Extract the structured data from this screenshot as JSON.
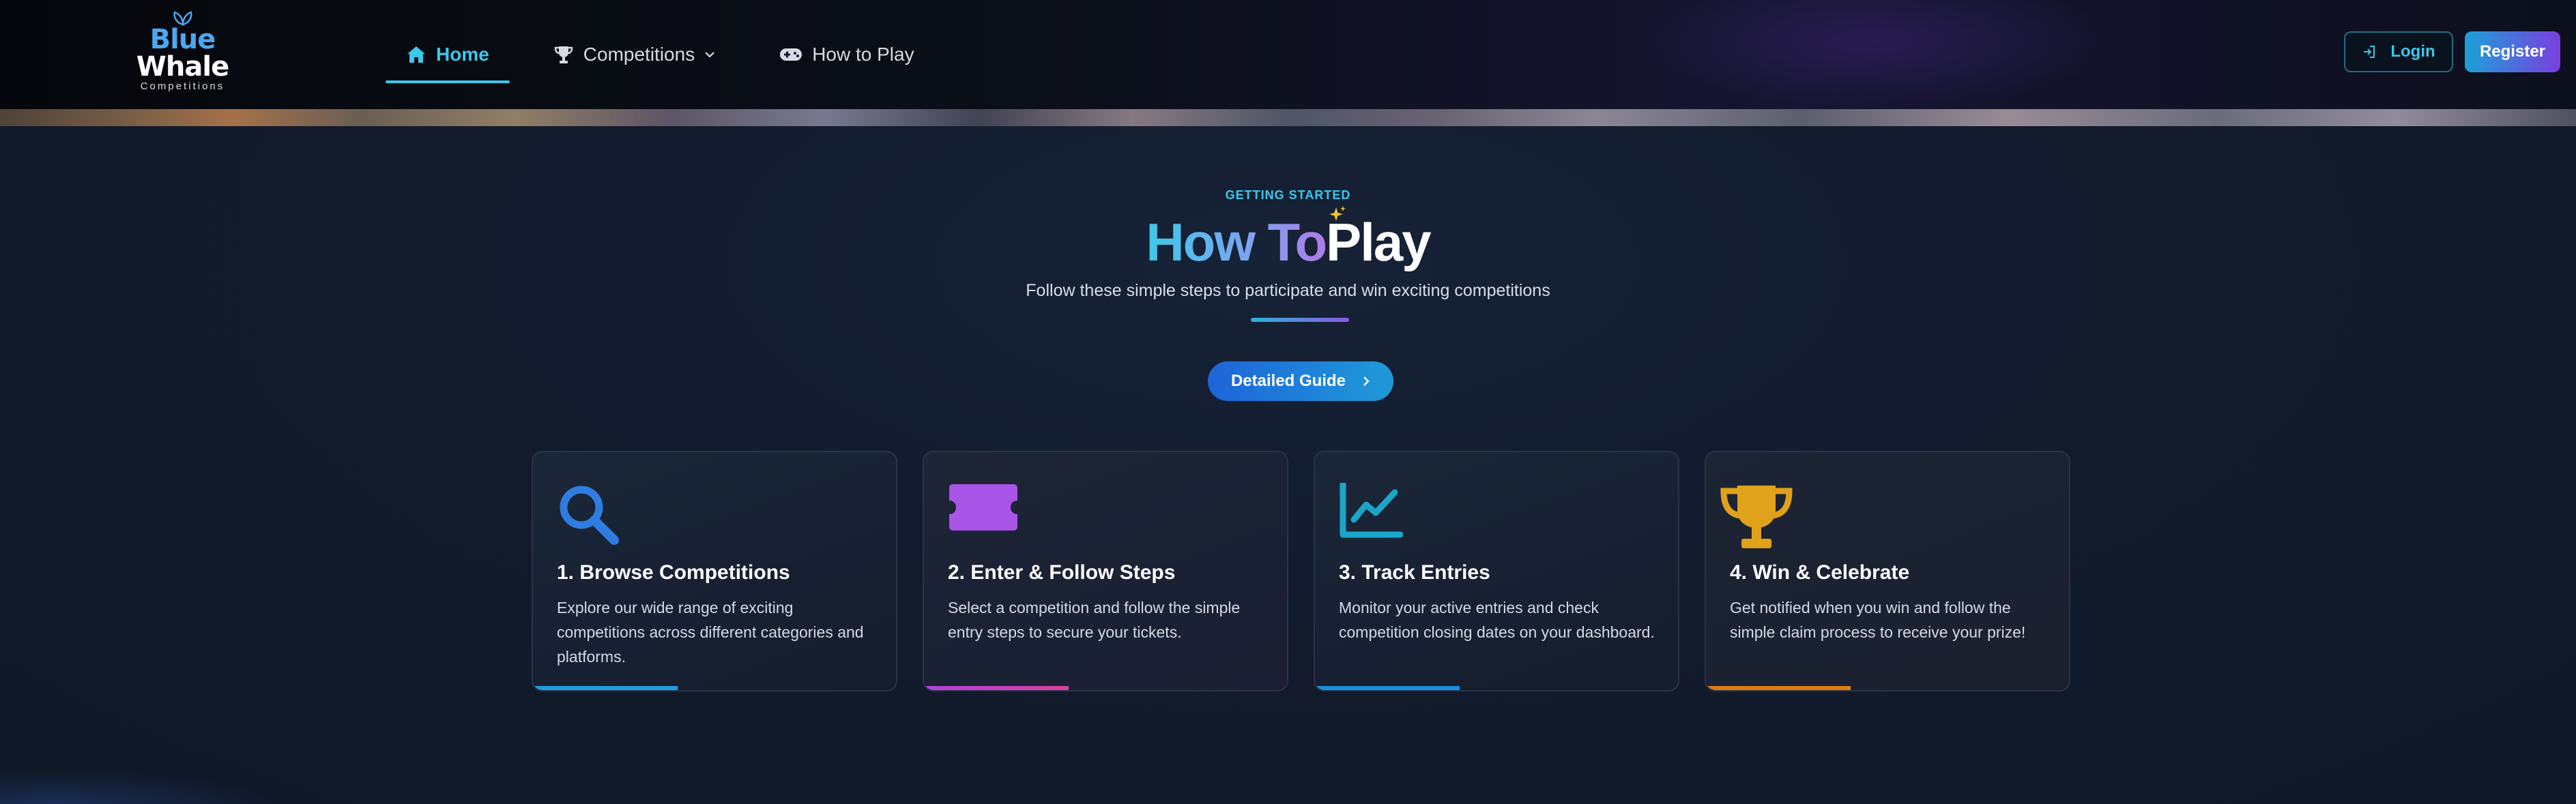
{
  "brand": {
    "line1": "Blue",
    "line2": "Whale",
    "line3": "Competitions",
    "icon": "leaf-icon"
  },
  "nav": {
    "items": [
      {
        "label": "Home",
        "icon": "home-icon",
        "active": true
      },
      {
        "label": "Competitions",
        "icon": "trophy-icon",
        "dropdown": true
      },
      {
        "label": "How to Play",
        "icon": "gamepad-icon"
      }
    ]
  },
  "auth": {
    "login_label": "Login",
    "register_label": "Register"
  },
  "hero": {
    "eyebrow": "GETTING STARTED",
    "title_part1": "How To",
    "title_part2": "Play",
    "subtitle": "Follow these simple steps to participate and win exciting competitions",
    "guide_button": "Detailed Guide"
  },
  "steps": [
    {
      "title": "1. Browse Competitions",
      "text": "Explore our wide range of exciting competitions across different categories and platforms.",
      "icon": "search-icon",
      "color": "#2f7de0",
      "bar": "#1ea0e0"
    },
    {
      "title": "2. Enter & Follow Steps",
      "text": "Select a competition and follow the simple entry steps to secure your tickets.",
      "icon": "ticket-icon",
      "color": "#a855e8",
      "bar": "#d040c0"
    },
    {
      "title": "3. Track Entries",
      "text": "Monitor your active entries and check competition closing dates on your dashboard.",
      "icon": "chart-line-icon",
      "color": "#1aa6c8",
      "bar": "#1a90e0"
    },
    {
      "title": "4. Win & Celebrate",
      "text": "Get notified when you win and follow the simple claim process to receive your prize!",
      "icon": "trophy-icon",
      "color": "#e0a21a",
      "bar": "#e07a10"
    }
  ]
}
